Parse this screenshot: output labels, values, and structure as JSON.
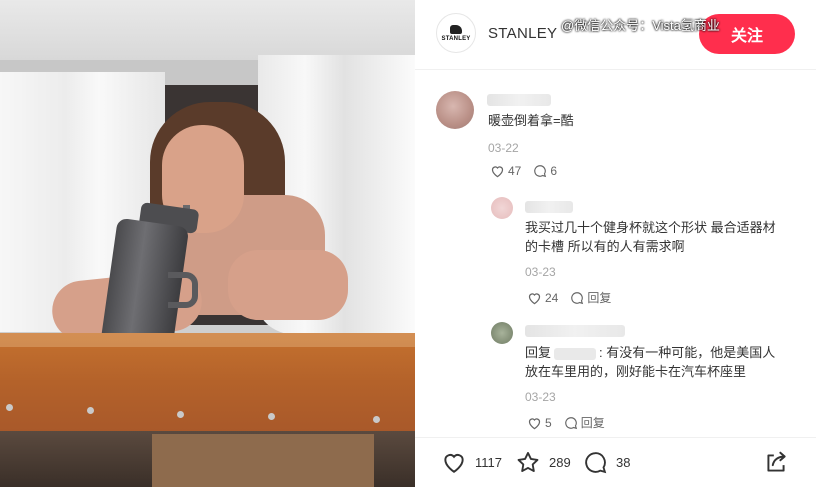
{
  "header": {
    "brand_name": "STANLEY",
    "logo_text": "STANLEY",
    "follow_label": "关注",
    "watermark": "@微信公众号：Vista氢商业"
  },
  "comments": [
    {
      "text": "暖壶倒着拿=酷",
      "date": "03-22",
      "likes": "47",
      "replies": "6"
    },
    {
      "text_line1": "我买过几十个健身杯就这个形状 最合适器材",
      "text_line2": "的卡槽 所以有的人有需求啊",
      "date": "03-23",
      "likes": "24",
      "reply_label": "回复"
    },
    {
      "reply_prefix": "回复",
      "text_line1_suffix": ": 有没有一种可能，他是美国人",
      "text_line2": "放在车里用的，刚好能卡在汽车杯座里",
      "date": "03-23",
      "likes": "5",
      "reply_label": "回复"
    }
  ],
  "footer": {
    "likes": "1117",
    "collects": "289",
    "comments": "38"
  },
  "icons": {
    "like": "heart-icon",
    "comment": "comment-icon",
    "collect": "star-icon",
    "share": "share-icon"
  },
  "colors": {
    "accent": "#ff2e4d",
    "muted_text": "#a5a5a5"
  }
}
